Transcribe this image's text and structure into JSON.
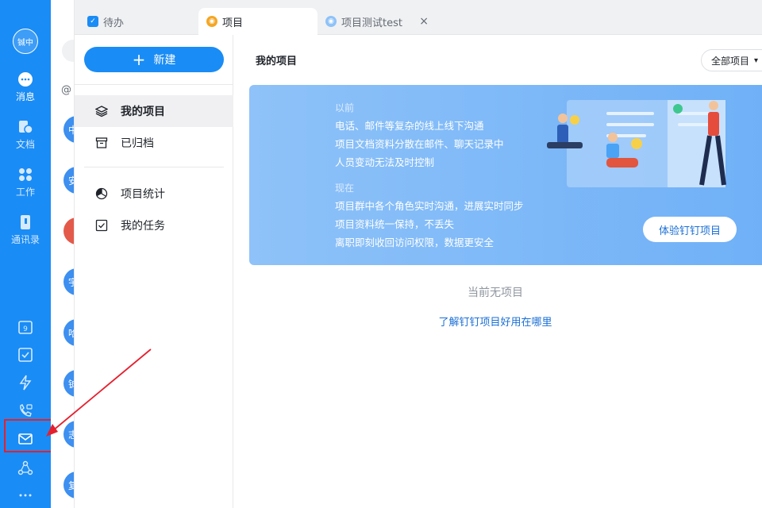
{
  "user": {
    "avatar_text": "铖中"
  },
  "rail": {
    "items": [
      {
        "label": "消息",
        "icon": "message-icon"
      },
      {
        "label": "文档",
        "icon": "document-icon"
      },
      {
        "label": "工作",
        "icon": "grid-icon"
      },
      {
        "label": "通讯录",
        "icon": "contacts-icon"
      }
    ],
    "bottom_icons": [
      "calendar-icon",
      "checkbox-icon",
      "lightning-icon",
      "phone-icon",
      "mail-icon",
      "share-icon",
      "more-icon"
    ]
  },
  "chatlist": {
    "at_symbol": "@",
    "avatars": [
      "中",
      "安",
      "",
      "宇",
      "哈",
      "铖",
      "志",
      "复"
    ]
  },
  "tabs": [
    {
      "label": "待办",
      "icon": "checkbox-icon"
    },
    {
      "label": "项目",
      "icon": "project-icon"
    },
    {
      "label": "项目测试test",
      "icon": "project-icon"
    }
  ],
  "tab_close": "×",
  "sidebar": {
    "new_label": "新建",
    "items": [
      {
        "label": "我的项目",
        "icon": "layers-icon"
      },
      {
        "label": "已归档",
        "icon": "archive-icon"
      },
      {
        "label": "项目统计",
        "icon": "pie-icon"
      },
      {
        "label": "我的任务",
        "icon": "task-check-icon"
      }
    ]
  },
  "main": {
    "title": "我的项目",
    "filter_label": "全部项目",
    "banner": {
      "before_label": "以前",
      "before_lines": [
        "电话、邮件等复杂的线上线下沟通",
        "项目文档资料分散在邮件、聊天记录中",
        "人员变动无法及时控制"
      ],
      "now_label": "现在",
      "now_lines": [
        "项目群中各个角色实时沟通，进展实时同步",
        "项目资料统一保持，不丢失",
        "离职即刻收回访问权限，数据更安全"
      ],
      "button_label": "体验钉钉项目"
    },
    "empty_text": "当前无项目",
    "learn_link": "了解钉钉项目好用在哪里"
  },
  "colors": {
    "accent": "#1a8cf5",
    "rail_bg": "#1a8cf5",
    "annotation_red": "#e5202e",
    "link": "#1a6fd6"
  }
}
